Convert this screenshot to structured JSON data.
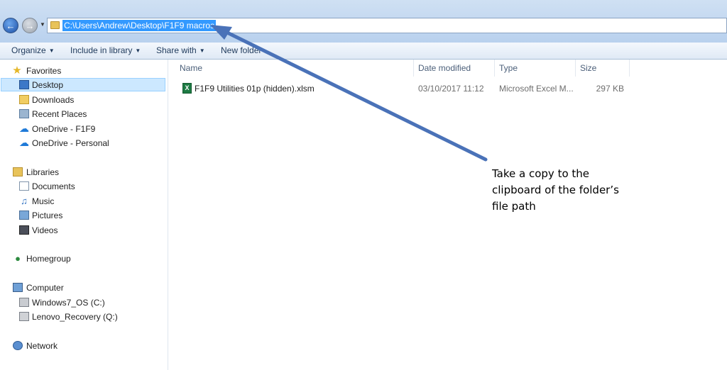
{
  "address_bar": {
    "path": "C:\\Users\\Andrew\\Desktop\\F1F9 macros"
  },
  "command_bar": {
    "organize": "Organize",
    "include_in_library": "Include in library",
    "share_with": "Share with",
    "new_folder": "New folder"
  },
  "nav_pane": {
    "favorites": "Favorites",
    "desktop": "Desktop",
    "downloads": "Downloads",
    "recent_places": "Recent Places",
    "onedrive_f1f9": "OneDrive - F1F9",
    "onedrive_personal": "OneDrive - Personal",
    "libraries": "Libraries",
    "documents": "Documents",
    "music": "Music",
    "pictures": "Pictures",
    "videos": "Videos",
    "homegroup": "Homegroup",
    "computer": "Computer",
    "windows7_os": "Windows7_OS (C:)",
    "lenovo_recovery": "Lenovo_Recovery (Q:)",
    "network": "Network"
  },
  "columns": {
    "name": "Name",
    "date_modified": "Date modified",
    "type": "Type",
    "size": "Size"
  },
  "files": [
    {
      "name": "F1F9 Utilities 01p (hidden).xlsm",
      "date_modified": "03/10/2017 11:12",
      "type": "Microsoft Excel M...",
      "size": "297 KB"
    }
  ],
  "annotation": {
    "line1": "Take a copy to the",
    "line2": "clipboard of the folder’s",
    "line3": "file path"
  },
  "colors": {
    "selection": "#3399ff",
    "arrow": "#4a72b8",
    "nav_highlight": "#cce8ff"
  }
}
